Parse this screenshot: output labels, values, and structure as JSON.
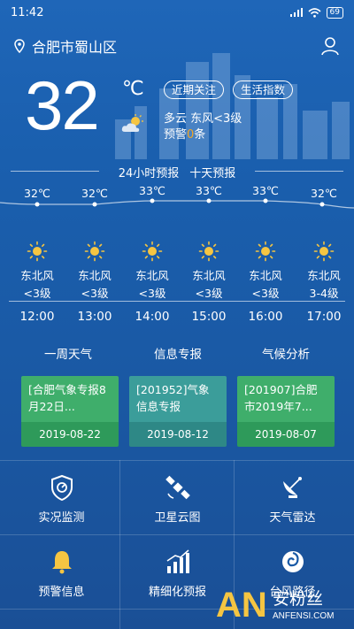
{
  "status_bar": {
    "time": "11:42",
    "battery": "69"
  },
  "header": {
    "location": "合肥市蜀山区"
  },
  "current": {
    "temp": "32",
    "unit": "℃",
    "pill_attention": "近期关注",
    "pill_life": "生活指数",
    "condition_line": "多云  东风<3级",
    "warning_prefix": "预警",
    "warning_count": "0",
    "warning_suffix": "条"
  },
  "forecast_tabs": {
    "hourly": "24小时预报",
    "ten_day": "十天预报"
  },
  "hourly": [
    {
      "temp": "32℃",
      "wind": "东北风",
      "level": "<3级",
      "time": "12:00"
    },
    {
      "temp": "32℃",
      "wind": "东北风",
      "level": "<3级",
      "time": "13:00"
    },
    {
      "temp": "33℃",
      "wind": "东北风",
      "level": "<3级",
      "time": "14:00"
    },
    {
      "temp": "33℃",
      "wind": "东北风",
      "level": "<3级",
      "time": "15:00"
    },
    {
      "temp": "33℃",
      "wind": "东北风",
      "level": "<3级",
      "time": "16:00"
    },
    {
      "temp": "32℃",
      "wind": "东北风",
      "level": "3-4级",
      "time": "17:00"
    }
  ],
  "sections": {
    "week": "一周天气",
    "info": "信息专报",
    "climate": "气候分析"
  },
  "cards": [
    {
      "text": "[合肥气象专报8月22日...",
      "date": "2019-08-22"
    },
    {
      "text": "[201952]气象信息专报",
      "date": "2019-08-12"
    },
    {
      "text": "[201907]合肥市2019年7...",
      "date": "2019-08-07"
    }
  ],
  "grid": [
    {
      "label": "实况监测",
      "icon": "monitor-shield-icon"
    },
    {
      "label": "卫星云图",
      "icon": "satellite-icon"
    },
    {
      "label": "天气雷达",
      "icon": "radar-dish-icon"
    },
    {
      "label": "预警信息",
      "icon": "alarm-bell-icon"
    },
    {
      "label": "精细化预报",
      "icon": "bar-chart-icon"
    },
    {
      "label": "台风路径",
      "icon": "typhoon-icon"
    }
  ],
  "watermark": {
    "brand": "安粉丝",
    "domain": "ANFENSI.COM"
  },
  "colors": {
    "warning": "#f5a623",
    "card_green": "#3fae6b",
    "card_teal": "#3b9d9a",
    "background": "#1a5aa6"
  }
}
